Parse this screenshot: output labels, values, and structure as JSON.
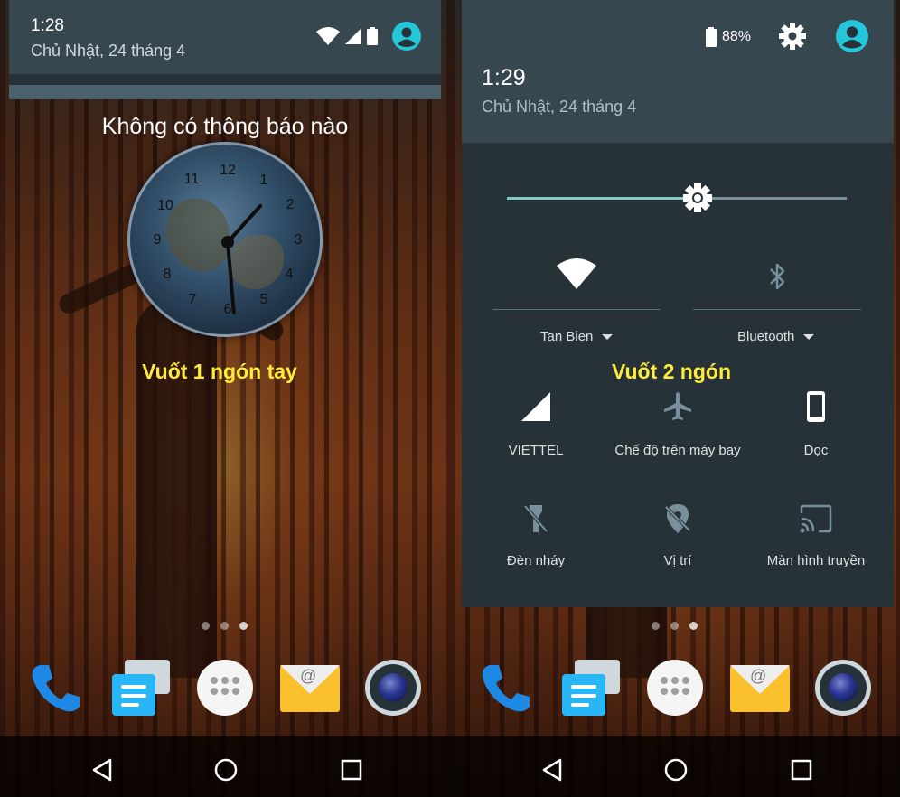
{
  "left": {
    "status": {
      "time": "1:28",
      "date": "Chủ Nhật, 24 tháng 4"
    },
    "no_notifications": "Không có thông báo nào",
    "clock_numbers": [
      "12",
      "1",
      "2",
      "3",
      "4",
      "5",
      "6",
      "7",
      "8",
      "9",
      "10",
      "11"
    ],
    "caption": "Vuốt 1 ngón tay"
  },
  "right": {
    "status": {
      "battery": "88%",
      "time": "1:29",
      "date": "Chủ Nhật, 24 tháng 4"
    },
    "brightness_level": 0.56,
    "tiles_top": [
      {
        "label": "Tan Bien",
        "icon": "wifi-icon",
        "dropdown": true
      },
      {
        "label": "Bluetooth",
        "icon": "bluetooth-off-icon",
        "dropdown": true
      }
    ],
    "caption": "Vuốt 2 ngón",
    "tiles_grid": [
      {
        "label": "VIETTEL",
        "icon": "cell-signal-icon"
      },
      {
        "label": "Chế độ trên máy bay",
        "icon": "airplane-icon"
      },
      {
        "label": "Dọc",
        "icon": "portrait-icon"
      },
      {
        "label": "Đèn nháy",
        "icon": "flashlight-off-icon"
      },
      {
        "label": "Vị trí",
        "icon": "location-off-icon"
      },
      {
        "label": "Màn hình truyền",
        "icon": "cast-icon"
      }
    ]
  },
  "dock": [
    "phone-icon",
    "messages-icon",
    "app-drawer-icon",
    "email-icon",
    "camera-icon"
  ],
  "navigation": [
    "back-icon",
    "home-icon",
    "recents-icon"
  ],
  "colors": {
    "accent": "#80cbc4",
    "caption": "#ffeb3b",
    "panel_header": "#37474f",
    "panel_body": "#263238",
    "avatar": "#26c6da"
  }
}
